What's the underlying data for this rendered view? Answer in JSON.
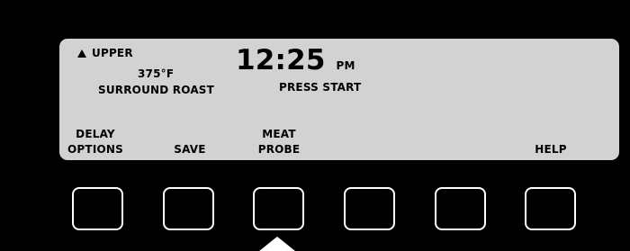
{
  "display": {
    "oven_label": "UPPER",
    "temperature": "375°F",
    "cook_mode": "SURROUND ROAST",
    "clock_time": "12:25",
    "clock_ampm": "PM",
    "status": "PRESS START"
  },
  "softkeys": [
    {
      "line1": "DELAY",
      "line2": "OPTIONS"
    },
    {
      "line1": "",
      "line2": "SAVE"
    },
    {
      "line1": "MEAT",
      "line2": "PROBE"
    },
    {
      "line1": "",
      "line2": ""
    },
    {
      "line1": "",
      "line2": ""
    },
    {
      "line1": "",
      "line2": "HELP"
    }
  ],
  "colors": {
    "panel": "#000000",
    "lcd": "#d2d2d2",
    "text": "#000000",
    "key_border": "#ffffff"
  },
  "icons": {
    "oven_indicator": "triangle-up-icon",
    "pointer": "arrow-up-icon"
  }
}
